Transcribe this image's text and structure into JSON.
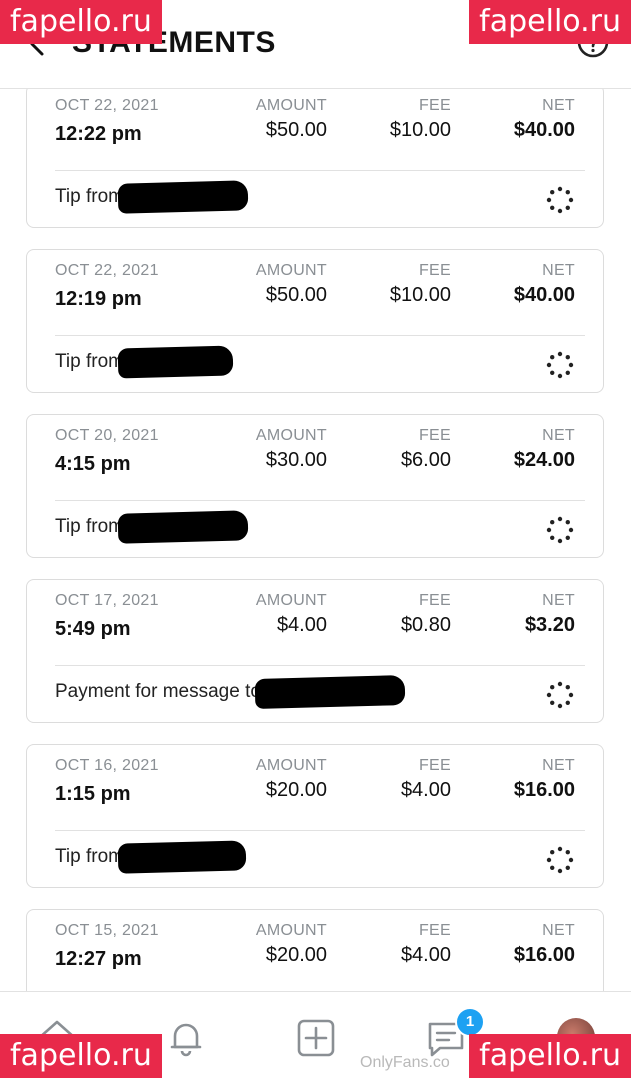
{
  "header": {
    "title": "STATEMENTS",
    "back_icon": "chevron-left-icon",
    "help_icon": "help-circle-icon"
  },
  "columns": {
    "amount": "AMOUNT",
    "fee": "FEE",
    "net": "NET"
  },
  "transactions": [
    {
      "date": "OCT 22, 2021",
      "time": "12:22 pm",
      "amount": "$50.00",
      "fee": "$10.00",
      "net": "$40.00",
      "description": "Tip from",
      "redacted_width": 130
    },
    {
      "date": "OCT 22, 2021",
      "time": "12:19 pm",
      "amount": "$50.00",
      "fee": "$10.00",
      "net": "$40.00",
      "description": "Tip from",
      "redacted_width": 115
    },
    {
      "date": "OCT 20, 2021",
      "time": "4:15 pm",
      "amount": "$30.00",
      "fee": "$6.00",
      "net": "$24.00",
      "description": "Tip from",
      "redacted_width": 130
    },
    {
      "date": "OCT 17, 2021",
      "time": "5:49 pm",
      "amount": "$4.00",
      "fee": "$0.80",
      "net": "$3.20",
      "description": "Payment for message to",
      "redacted_width": 150
    },
    {
      "date": "OCT 16, 2021",
      "time": "1:15 pm",
      "amount": "$20.00",
      "fee": "$4.00",
      "net": "$16.00",
      "description": "Tip from",
      "redacted_width": 128
    },
    {
      "date": "OCT 15, 2021",
      "time": "12:27 pm",
      "amount": "$20.00",
      "fee": "$4.00",
      "net": "$16.00",
      "description": "",
      "redacted_width": 0
    }
  ],
  "bottom_nav": {
    "items": [
      "home-icon",
      "bell-icon",
      "plus-square-icon",
      "messages-icon",
      "avatar"
    ],
    "messages_badge": "1"
  },
  "site_mark": "OnlyFans.co",
  "watermarks": [
    "fapello.ru",
    "fapello.ru",
    "fapello.ru",
    "fapello.ru"
  ],
  "colors": {
    "badge": "#1da1f2",
    "watermark": "#e8294a",
    "muted_text": "#8a8f94"
  }
}
